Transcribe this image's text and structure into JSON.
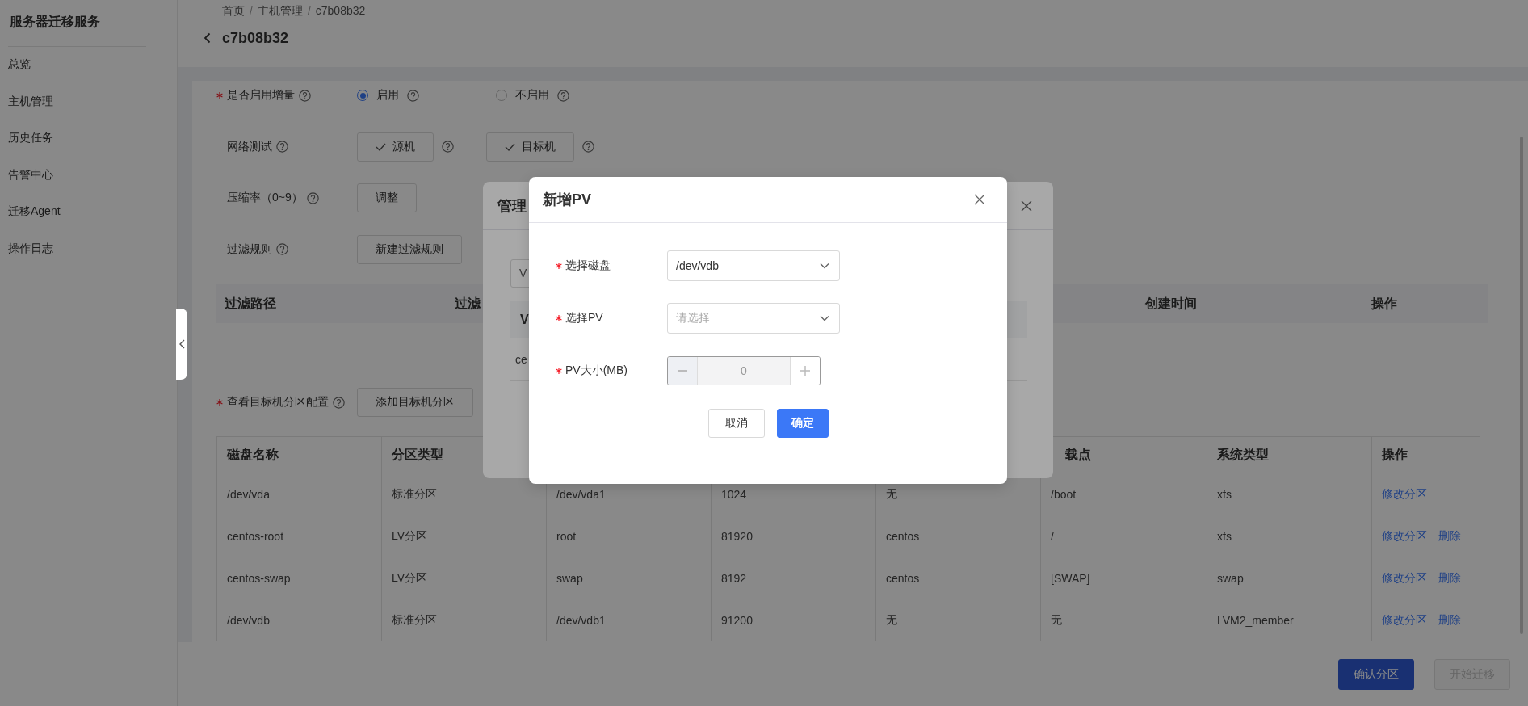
{
  "sidebar": {
    "title": "服务器迁移服务",
    "items": [
      "总览",
      "主机管理",
      "历史任务",
      "告警中心",
      "迁移Agent",
      "操作日志"
    ]
  },
  "breadcrumb": [
    {
      "kind": "link",
      "text": "首页"
    },
    {
      "kind": "separator",
      "text": "/"
    },
    {
      "kind": "link",
      "text": "主机管理"
    },
    {
      "kind": "separator",
      "text": "/"
    },
    {
      "kind": "current",
      "text": "c7b08b32"
    }
  ],
  "page_title": "c7b08b32",
  "form": {
    "rows": [
      {
        "kind": "radio",
        "label": "是否启用增量",
        "required": true,
        "help": true,
        "options": [
          {
            "label": "启用",
            "help": true,
            "selected": true
          },
          {
            "label": "不启用",
            "help": true,
            "selected": false
          }
        ]
      },
      {
        "kind": "buttons",
        "label": "网络测试",
        "required": false,
        "help": true,
        "buttons": [
          {
            "label": "源机",
            "checked": true,
            "help": true
          },
          {
            "label": "目标机",
            "checked": true,
            "help": true
          }
        ]
      },
      {
        "kind": "buttons",
        "label": "压缩率（0~9）",
        "required": false,
        "help": true,
        "buttons": [
          {
            "label": "调整",
            "checked": false,
            "help": false
          }
        ]
      },
      {
        "kind": "buttons",
        "label": "过滤规则",
        "required": false,
        "help": true,
        "buttons": [
          {
            "label": "新建过滤规则",
            "checked": false,
            "help": false
          }
        ]
      }
    ]
  },
  "filter_table": {
    "columns": [
      "过滤路径",
      "过滤",
      "创建时间",
      "操作"
    ]
  },
  "partition": {
    "label": "查看目标机分区配置",
    "required": true,
    "help": true,
    "button": "添加目标机分区"
  },
  "partition_table": {
    "columns": [
      "磁盘名称",
      "分区类型",
      null,
      null,
      null,
      "载点",
      "系统类型",
      "操作"
    ],
    "rows": [
      {
        "cells": [
          "/dev/vda",
          "标准分区",
          "/dev/vda1",
          "1024",
          "无",
          "/boot",
          "xfs"
        ],
        "actions": [
          "修改分区"
        ]
      },
      {
        "cells": [
          "centos-root",
          "LV分区",
          "root",
          "81920",
          "centos",
          "/",
          "xfs"
        ],
        "actions": [
          "修改分区",
          "删除"
        ]
      },
      {
        "cells": [
          "centos-swap",
          "LV分区",
          "swap",
          "8192",
          "centos",
          "[SWAP]",
          "swap"
        ],
        "actions": [
          "修改分区",
          "删除"
        ]
      },
      {
        "cells": [
          "/dev/vdb",
          "标准分区",
          "/dev/vdb1",
          "91200",
          "无",
          "无",
          "LVM2_member"
        ],
        "actions": [
          "修改分区",
          "删除"
        ]
      }
    ]
  },
  "footer": {
    "buttons": [
      {
        "label": "确认分区",
        "kind": "primary",
        "disabled": false
      },
      {
        "label": "开始迁移",
        "kind": "default",
        "disabled": true
      }
    ]
  },
  "back_dialog": {
    "title": "管理",
    "input_value": "V",
    "table_header": "V",
    "row_text": "ce"
  },
  "dialog": {
    "title": "新增PV",
    "fields": [
      {
        "kind": "select",
        "label": "选择磁盘",
        "required": true,
        "value": "/dev/vdb"
      },
      {
        "kind": "select",
        "label": "选择PV",
        "required": true,
        "placeholder": "请选择"
      },
      {
        "kind": "number",
        "label": "PV大小(MB)",
        "required": true,
        "value": "0",
        "disabled": true
      }
    ],
    "buttons": [
      {
        "label": "取消",
        "kind": "default"
      },
      {
        "label": "确定",
        "kind": "primary"
      }
    ]
  }
}
